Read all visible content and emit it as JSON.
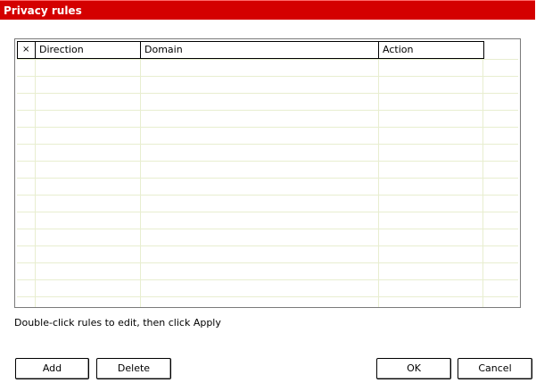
{
  "window": {
    "title": "Privacy rules"
  },
  "table": {
    "columns": [
      "×",
      "Direction",
      "Domain",
      "Action"
    ],
    "rows": []
  },
  "hint": "Double-click rules to edit, then click Apply",
  "buttons": {
    "add": "Add",
    "delete": "Delete",
    "ok": "OK",
    "cancel": "Cancel"
  },
  "colors": {
    "titlebar": "#d40000",
    "grid_lines": "#e8eed0"
  }
}
